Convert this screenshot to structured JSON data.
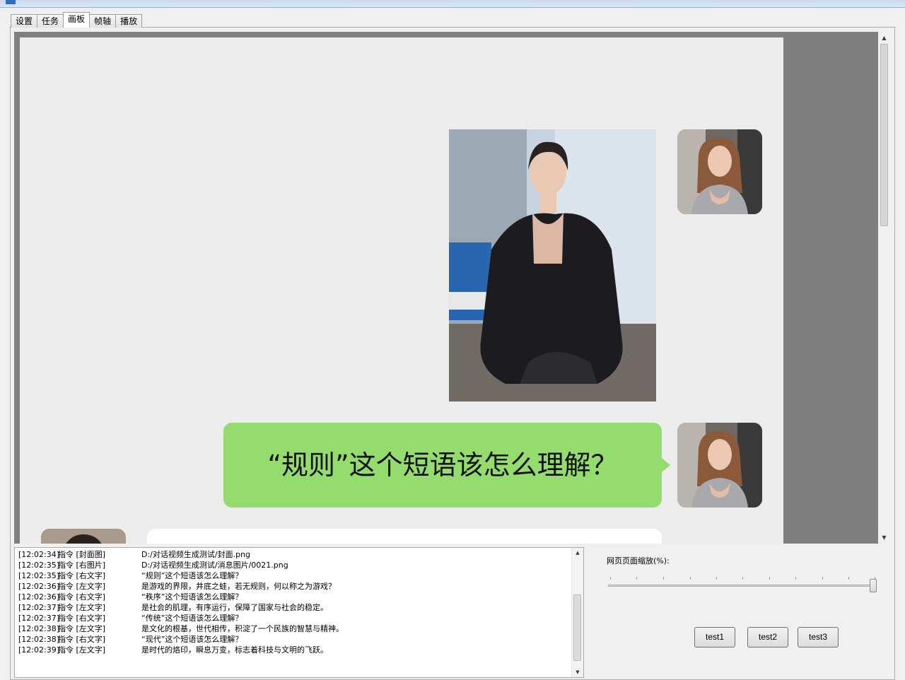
{
  "tabs": [
    "设置",
    "任务",
    "画板",
    "帧轴",
    "播放"
  ],
  "active_tab": "画板",
  "chat": {
    "bubble_text": "“规则”这个短语该怎么理解？"
  },
  "log": {
    "lines": [
      {
        "time": "[12:02:34]",
        "cmd": "指令 [封面图]",
        "content": "D:/对话视频生成测试/封面.png"
      },
      {
        "time": "[12:02:35]",
        "cmd": "指令 [右图片]",
        "content": "D:/对话视频生成测试/消息图片/0021.png"
      },
      {
        "time": "[12:02:35]",
        "cmd": "指令 [右文字]",
        "content": "“规则”这个短语该怎么理解？"
      },
      {
        "time": "[12:02:36]",
        "cmd": "指令 [左文字]",
        "content": "是游戏的界限，井底之蛙，若无规则，何以称之为游戏？"
      },
      {
        "time": "[12:02:36]",
        "cmd": "指令 [右文字]",
        "content": "“秩序”这个短语该怎么理解？"
      },
      {
        "time": "[12:02:37]",
        "cmd": "指令 [左文字]",
        "content": "是社会的肌理，有序运行，保障了国家与社会的稳定。"
      },
      {
        "time": "[12:02:37]",
        "cmd": "指令 [右文字]",
        "content": "“传统”这个短语该怎么理解？"
      },
      {
        "time": "[12:02:38]",
        "cmd": "指令 [左文字]",
        "content": "是文化的根基，世代相传，积淀了一个民族的智慧与精神。"
      },
      {
        "time": "[12:02:38]",
        "cmd": "指令 [右文字]",
        "content": "“现代”这个短语该怎么理解？"
      },
      {
        "time": "[12:02:39]",
        "cmd": "指令 [左文字]",
        "content": "是时代的烙印，瞬息万变，标志着科技与文明的飞跃。"
      }
    ]
  },
  "zoom": {
    "label": "网页页面缩放(%):",
    "value_fraction": 1.0
  },
  "buttons": [
    "test1",
    "test2",
    "test3"
  ],
  "colors": {
    "bubble_green": "#95dc6e",
    "canvas_bg": "#ececec",
    "frame_gray": "#7f7f7f"
  }
}
